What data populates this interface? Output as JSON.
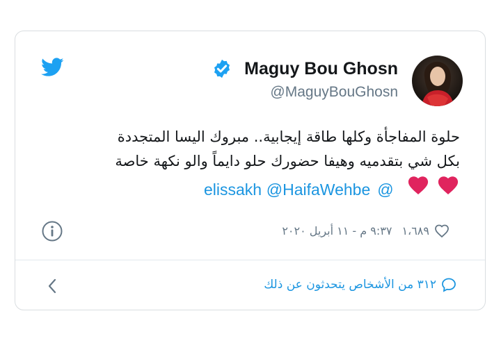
{
  "author": {
    "name": "Maguy Bou Ghosn",
    "handle": "@MaguyBouGhosn",
    "verified": true
  },
  "tweet": {
    "lines": [
      "حلوة المفاجأة وكلها طاقة إيجابية.. مبروك اليسا المتجددة",
      "بكل شي بتقدميه وهيفا حضورك حلو دايماً والو نكهة خاصة"
    ],
    "hearts": 2,
    "mentions": [
      "@elissakh",
      "@HaifaWehbe"
    ]
  },
  "meta": {
    "timestamp": "٩:٣٧ م - ١١ أبريل ٢٠٢٠",
    "likes": "١،٦٨٩"
  },
  "footer": {
    "people_text": "٣١٢ من الأشخاص يتحدثون عن ذلك"
  },
  "colors": {
    "brand_blue": "#1da1f2",
    "link_blue": "#1b95e0",
    "heart_red": "#e0245e",
    "muted": "#657786"
  },
  "icons": [
    "twitter-logo-icon",
    "verified-badge-icon",
    "heart-emoji-icon",
    "info-icon",
    "like-heart-icon",
    "comment-bubble-icon",
    "chevron-left-icon"
  ]
}
